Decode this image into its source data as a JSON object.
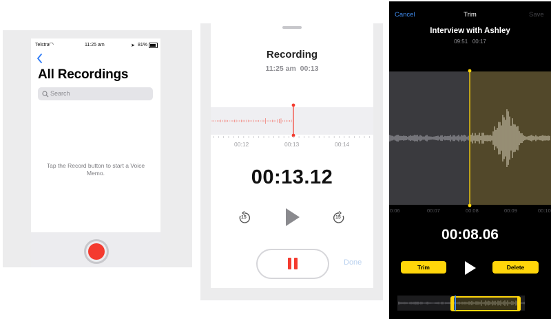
{
  "panel1": {
    "status": {
      "carrier": "Telstra",
      "time": "11:25 am",
      "battery": "81%"
    },
    "title": "All Recordings",
    "search_placeholder": "Search",
    "empty_message": "Tap the Record button to start a Voice Memo."
  },
  "panel2": {
    "title": "Recording",
    "subtitle_time": "11:25 am",
    "subtitle_duration": "00:13",
    "ticks": [
      "00:12",
      "00:13",
      "00:14"
    ],
    "timer": "00:13.12",
    "skip_back_label": "15",
    "skip_fwd_label": "15",
    "done_label": "Done"
  },
  "panel3": {
    "cancel_label": "Cancel",
    "title": "Trim",
    "save_label": "Save",
    "recording_name": "Interview with Ashley",
    "meta_time": "09:51",
    "meta_duration": "00:17",
    "axis": [
      "0:06",
      "00:07",
      "00:08",
      "00:09",
      "00:10"
    ],
    "timer": "00:08.06",
    "trim_label": "Trim",
    "delete_label": "Delete"
  },
  "colors": {
    "record_red": "#f43b2f",
    "ios_blue": "#3f8cf0",
    "trim_yellow": "#ffd60a"
  }
}
